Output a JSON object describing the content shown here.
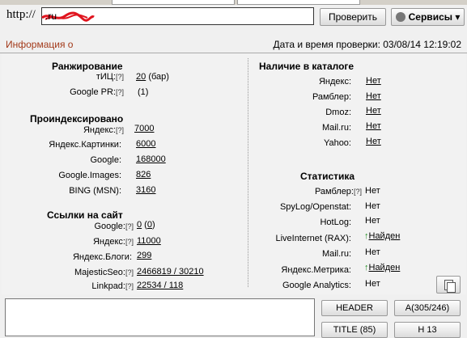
{
  "url_prefix": "http://",
  "url_value": "      .ru",
  "check_label": "Проверить",
  "services_label": "Сервисы ▾",
  "info_label": "Информация о",
  "datetime_label": "Дата и время проверки: 03/08/14 12:19:02",
  "q": "[?]",
  "ranking": {
    "title": "Ранжирование",
    "tic_label": "тИЦ:",
    "tic_value": "20",
    "tic_note": "(бар)",
    "pr_label": "Google PR:",
    "pr_value": "(1)"
  },
  "indexed": {
    "title": "Проиндексировано",
    "yandex_label": "Яндекс:",
    "yandex_value": "7000",
    "ykart_label": "Яндекс.Картинки:",
    "ykart_value": "6000",
    "google_label": "Google:",
    "google_value": "168000",
    "gimages_label": "Google.Images:",
    "gimages_value": "826",
    "bing_label": "BING (MSN):",
    "bing_value": "3160"
  },
  "links": {
    "title": "Ссылки на сайт",
    "google_label": "Google:",
    "google_value": "0",
    "google_paren": "0",
    "yandex_label": "Яндекс:",
    "yandex_value": "11000",
    "yblogs_label": "Яндекс.Блоги:",
    "yblogs_value": "299",
    "majestic_label": "MajesticSeo:",
    "majestic_value": "2466819 / 30210",
    "linkpad_label": "Linkpad:",
    "linkpad_value": "22534 / 118"
  },
  "catalog": {
    "title": "Наличие в каталоге",
    "yandex_label": "Яндекс:",
    "yandex_value": "Нет",
    "rambler_label": "Рамблер:",
    "rambler_value": "Нет",
    "dmoz_label": "Dmoz:",
    "dmoz_value": "Нет",
    "mailru_label": "Mail.ru:",
    "mailru_value": "Нет",
    "yahoo_label": "Yahoo:",
    "yahoo_value": "Нет"
  },
  "stats": {
    "title": "Статистика",
    "rambler_label": "Рамблер:",
    "rambler_value": "Нет",
    "spylog_label": "SpyLog/Openstat:",
    "spylog_value": "Нет",
    "hotlog_label": "HotLog:",
    "hotlog_value": "Нет",
    "li_label": "LiveInternet (RAX):",
    "li_value": "Найден",
    "mailru_label": "Mail.ru:",
    "mailru_value": "Нет",
    "ymetrika_label": "Яндекс.Метрика:",
    "ymetrika_value": "Найден",
    "ga_label": "Google Analytics:",
    "ga_value": "Нет"
  },
  "bottom": {
    "header_label": "HEADER",
    "a_label": "A(305/246)",
    "title_label": "TITLE (85)",
    "h_label": "H 13"
  },
  "colors": {
    "info": "#a33a1a",
    "found_arrow": "#1a8a1a",
    "scribble": "#e0141e"
  }
}
